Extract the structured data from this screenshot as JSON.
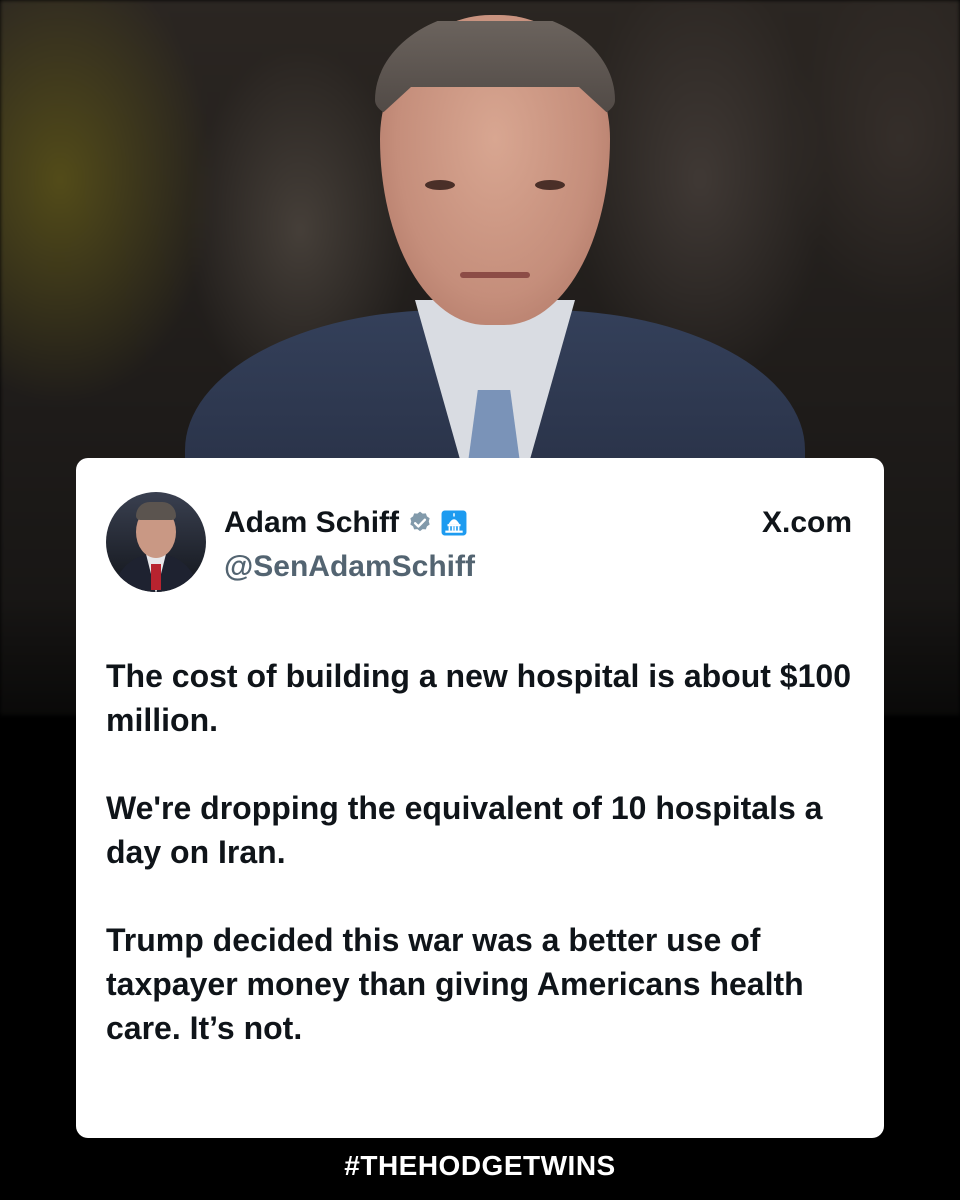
{
  "tweet": {
    "author_name": "Adam Schiff",
    "handle": "@SenAdamSchiff",
    "source": "X.com",
    "paragraphs": [
      "The cost of building a new hospital is about $100 million.",
      "We're dropping the equivalent of 10 hospitals a day on Iran.",
      "Trump decided this war was a better use of taxpayer money than giving Americans health care. It’s not."
    ]
  },
  "footer": {
    "tag": "#THEHODGETWINS"
  },
  "icons": {
    "verified": "verified-badge-icon",
    "affiliation": "capitol-icon"
  },
  "colors": {
    "card_bg": "#ffffff",
    "text_primary": "#0f1419",
    "text_secondary": "#536471",
    "verified_badge": "#829aab",
    "affiliation_badge": "#1d9bf0",
    "page_bg": "#000000"
  }
}
